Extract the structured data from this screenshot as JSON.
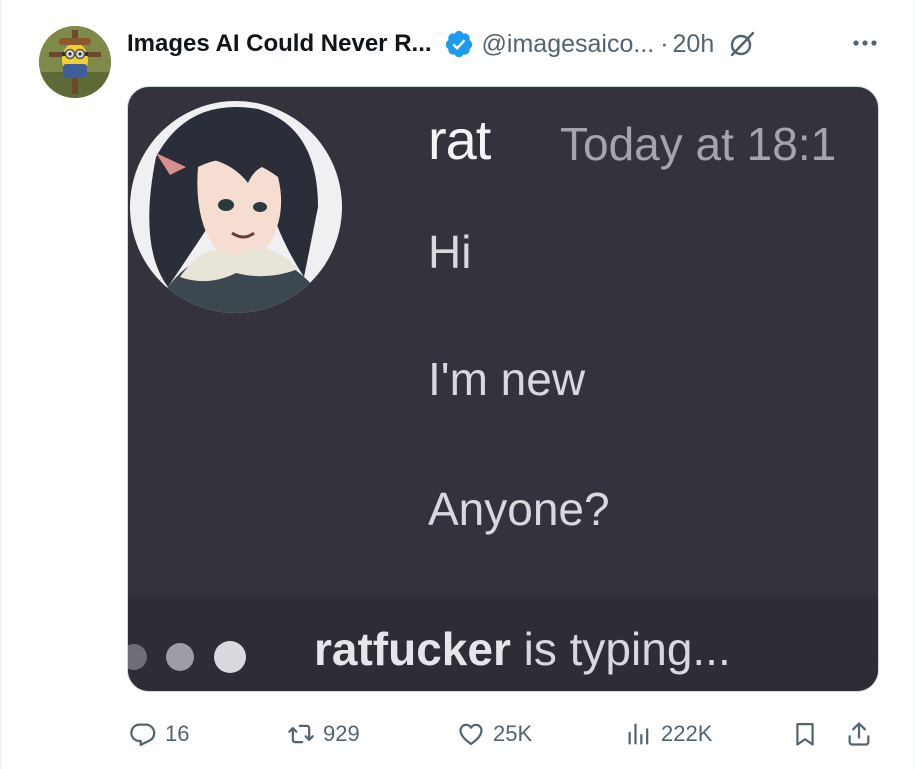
{
  "tweet": {
    "author": {
      "display_name": "Images AI Could Never R...",
      "handle": "@imagesaico...",
      "verified": true,
      "avatar_icon": "minion-scarecrow-avatar"
    },
    "separator": "·",
    "time": "20h",
    "icons": {
      "grok": "grok-icon",
      "more": "more-icon"
    },
    "media": {
      "username": "rat",
      "timestamp": "Today at 18:1",
      "messages": [
        "Hi",
        "I'm new",
        "Anyone?"
      ],
      "typing_user": "ratfucker",
      "typing_suffix": " is typing..."
    },
    "stats": {
      "replies": "16",
      "retweets": "929",
      "likes": "25K",
      "views": "222K"
    }
  },
  "colors": {
    "verified": "#1d9bf0",
    "muted_text": "#536471",
    "media_bg": "#34333d"
  }
}
